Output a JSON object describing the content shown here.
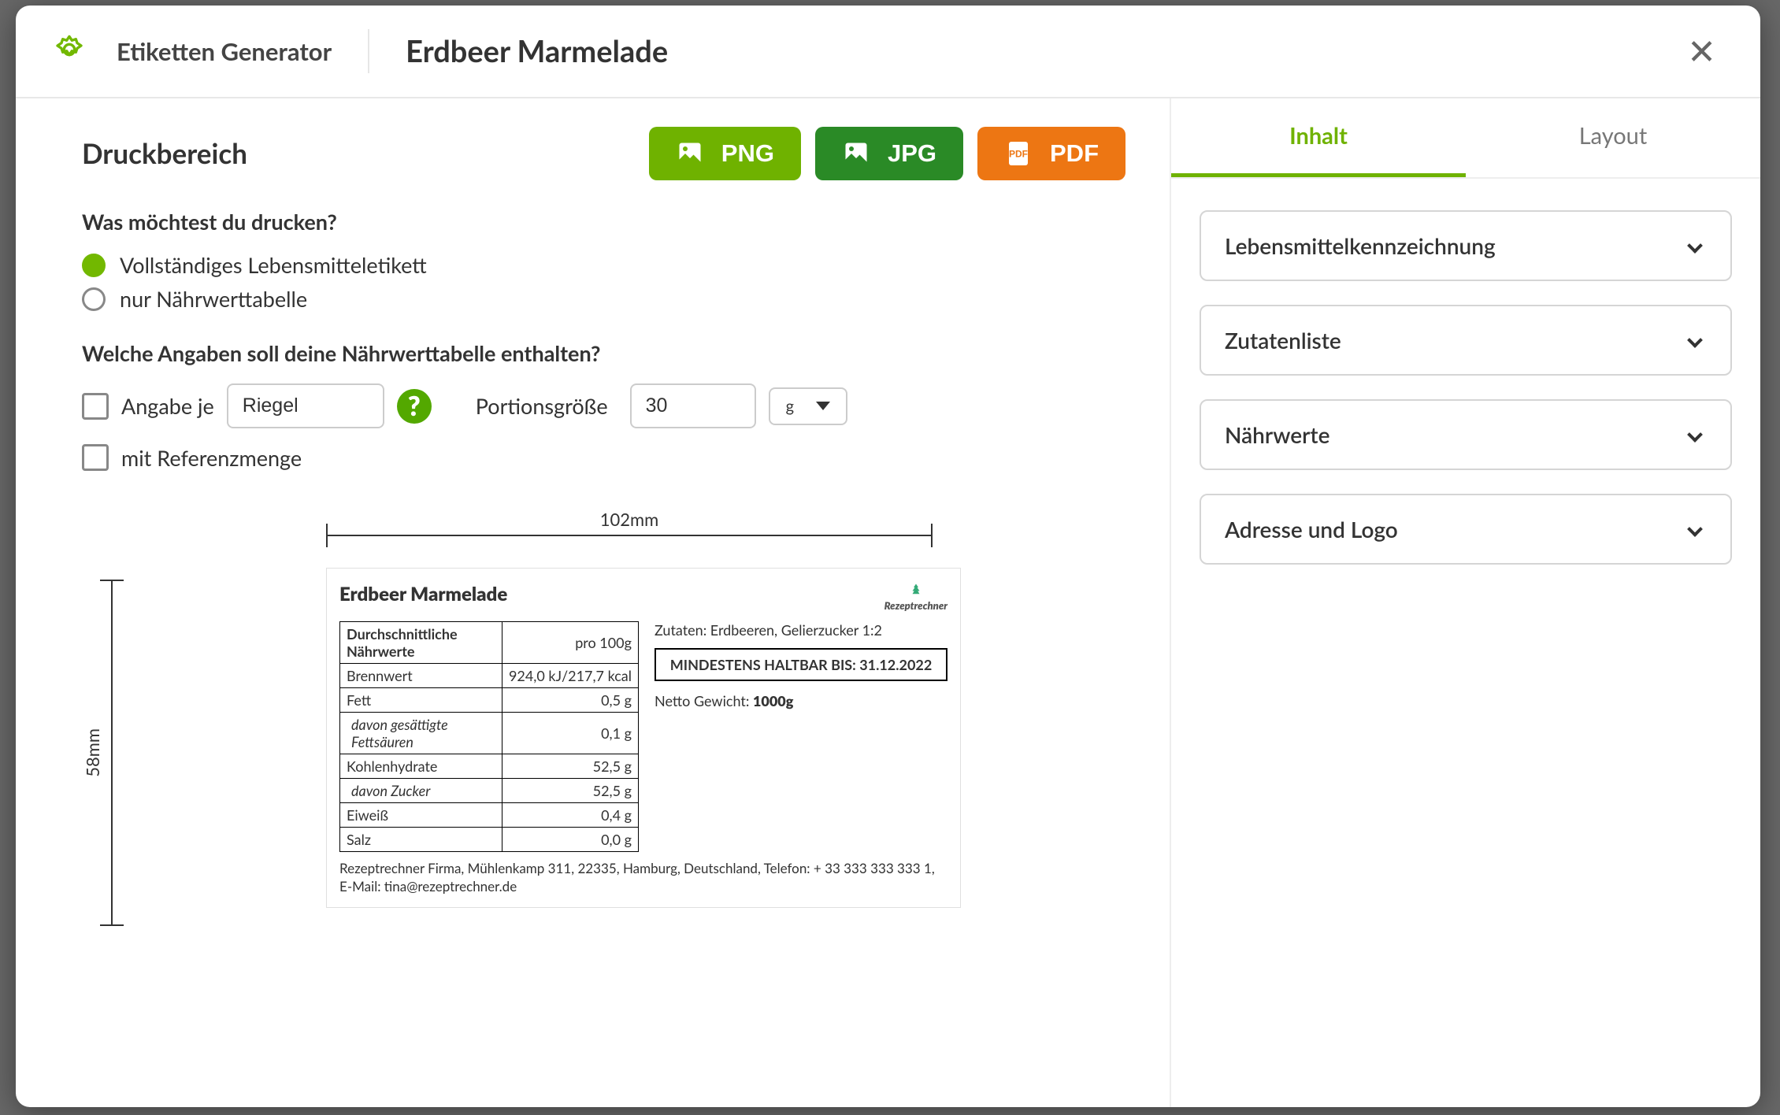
{
  "header": {
    "brand": "Etiketten Generator",
    "recipe_title": "Erdbeer Marmelade"
  },
  "left": {
    "section_title": "Druckbereich",
    "export": {
      "png": "PNG",
      "jpg": "JPG",
      "pdf": "PDF"
    },
    "q1": "Was möchtest du drucken?",
    "radio_options": {
      "full": "Vollständiges Lebensmitteletikett",
      "only_table": "nur Nährwerttabelle"
    },
    "radio_selected": "full",
    "q2": "Welche Angaben soll deine Nährwerttabelle enthalten?",
    "per_unit_label": "Angabe je",
    "per_unit_value": "Riegel",
    "portion_label": "Portionsgröße",
    "portion_value": "30",
    "portion_unit": "g",
    "ref_label": "mit Referenzmenge"
  },
  "preview": {
    "width_label": "102mm",
    "height_label": "58mm",
    "product_title": "Erdbeer Marmelade",
    "brand_mark": "Rezeptrechner",
    "nut_header_left": "Durchschnittliche Nährwerte",
    "nut_header_right": "pro 100g",
    "nut_rows": [
      {
        "k": "Brennwert",
        "v": "924,0 kJ/217,7 kcal",
        "indent": false
      },
      {
        "k": "Fett",
        "v": "0,5 g",
        "indent": false
      },
      {
        "k": "davon gesättigte Fettsäuren",
        "v": "0,1 g",
        "indent": true
      },
      {
        "k": "Kohlenhydrate",
        "v": "52,5 g",
        "indent": false
      },
      {
        "k": "davon Zucker",
        "v": "52,5 g",
        "indent": true
      },
      {
        "k": "Eiweiß",
        "v": "0,4 g",
        "indent": false
      },
      {
        "k": "Salz",
        "v": "0,0 g",
        "indent": false
      }
    ],
    "zutaten": "Zutaten: Erdbeeren, Gelierzucker 1:2",
    "mhd": "MINDESTENS HALTBAR BIS: 31.12.2022",
    "netto_label": "Netto Gewicht: ",
    "netto_value": "1000g",
    "address": "Rezeptrechner Firma, Mühlenkamp 311, 22335, Hamburg, Deutschland, Telefon: + 33 333 333 333 1, E-Mail: tina@rezeptrechner.de"
  },
  "right": {
    "tabs": {
      "inhalt": "Inhalt",
      "layout": "Layout",
      "active": "inhalt"
    },
    "accordion": [
      "Lebensmittelkennzeichnung",
      "Zutatenliste",
      "Nährwerte",
      "Adresse und Logo"
    ]
  }
}
